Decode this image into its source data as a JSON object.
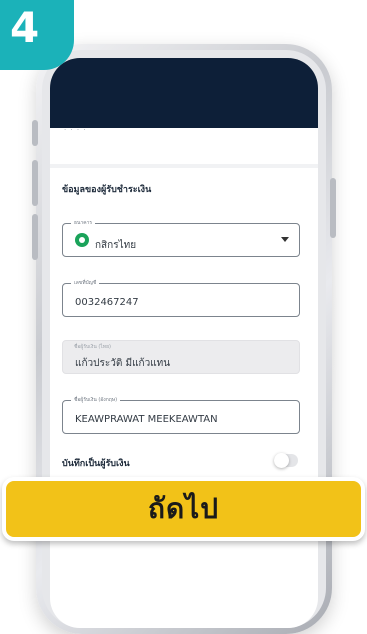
{
  "step": {
    "number": "4"
  },
  "app": {
    "subheader": "·  ·  ·  ·",
    "section_title": "ข้อมูลของผู้รับชำระเงิน",
    "fields": {
      "bank": {
        "label": "ธนาคาร",
        "value": "กสิกรไทย",
        "logo": "kbank-logo"
      },
      "account": {
        "label": "เลขที่บัญชี",
        "value": "0032467247"
      },
      "name_th": {
        "label": "ชื่อผู้รับเงิน (ไทย)",
        "value": "แก้วประวัติ มีแก้วแทน"
      },
      "name_en": {
        "label": "ชื่อผู้รับเงิน (อังกฤษ)",
        "value": "KEAWPRAWAT MEEKEAWTAN"
      }
    },
    "save_payee": {
      "label": "บันทึกเป็นผู้รับเงิน",
      "enabled": false
    }
  },
  "cta": {
    "label": "ถัดไป"
  },
  "colors": {
    "header": "#0d1f38",
    "badge": "#1bb2b9",
    "button": "#f2c218",
    "bank_green": "#1aa35a"
  }
}
